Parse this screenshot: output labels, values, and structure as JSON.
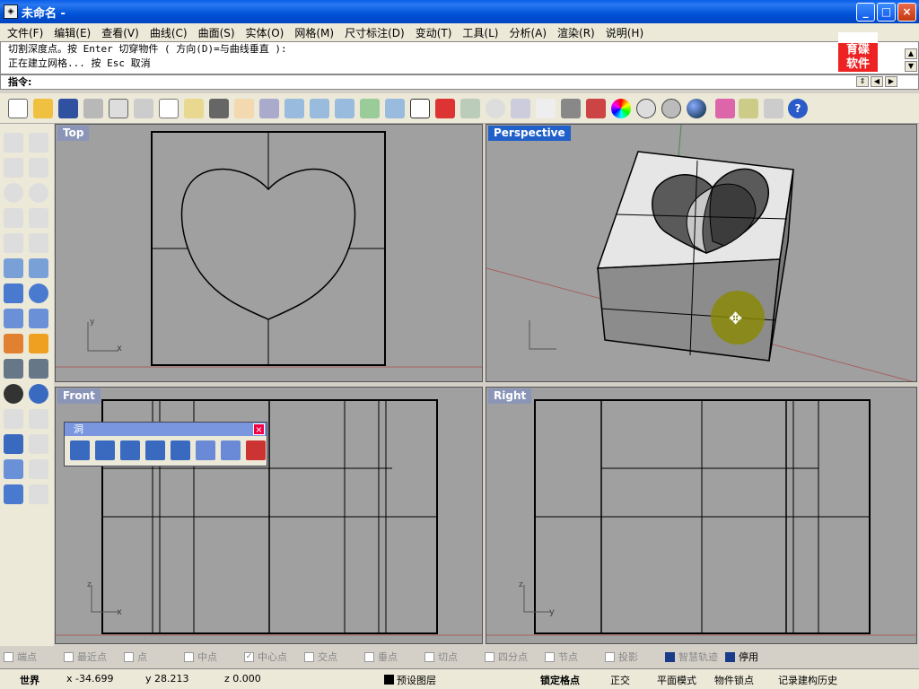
{
  "window": {
    "title": "未命名 -",
    "minimize": "_",
    "maximize": "□",
    "close": "×"
  },
  "menu": [
    "文件(F)",
    "编辑(E)",
    "查看(V)",
    "曲线(C)",
    "曲面(S)",
    "实体(O)",
    "网格(M)",
    "尺寸标注(D)",
    "变动(T)",
    "工具(L)",
    "分析(A)",
    "渲染(R)",
    "说明(H)"
  ],
  "command": {
    "line1": "切割深度点。按 Enter 切穿物件 ( 方向(D)=与曲线垂直 ):",
    "line2": "正在建立网格... 按 Esc 取消",
    "prompt": "指令:"
  },
  "logo": {
    "line1": "育碟",
    "line2": "软件"
  },
  "viewports": {
    "top": "Top",
    "perspective": "Perspective",
    "front": "Front",
    "right": "Right"
  },
  "axes": {
    "x": "x",
    "y": "y",
    "z": "z"
  },
  "hole_panel": {
    "title": "洞",
    "close": "×"
  },
  "osnap": [
    {
      "label": "端点",
      "checked": false
    },
    {
      "label": "最近点",
      "checked": false
    },
    {
      "label": "点",
      "checked": false
    },
    {
      "label": "中点",
      "checked": false
    },
    {
      "label": "中心点",
      "checked": true
    },
    {
      "label": "交点",
      "checked": false
    },
    {
      "label": "垂点",
      "checked": false
    },
    {
      "label": "切点",
      "checked": false
    },
    {
      "label": "四分点",
      "checked": false
    },
    {
      "label": "节点",
      "checked": false
    },
    {
      "label": "投影",
      "checked": false
    },
    {
      "label": "智慧轨迹",
      "checked": true
    },
    {
      "label": "停用",
      "checked": true
    }
  ],
  "status": {
    "world": "世界",
    "x": "x -34.699",
    "y": "y 28.213",
    "z": "z 0.000",
    "layer": "预设图层",
    "grid_snap": "锁定格点",
    "ortho": "正交",
    "planar": "平面模式",
    "osnap": "物件锁点",
    "history": "记录建构历史"
  },
  "colors": {
    "title_bar": "#0054e3",
    "viewport_bg": "#a0a0a0",
    "active_label": "#2060c8",
    "inactive_label": "#8a95b8",
    "model_light": "#e6e6e6",
    "model_dark": "#8c8c8c"
  }
}
